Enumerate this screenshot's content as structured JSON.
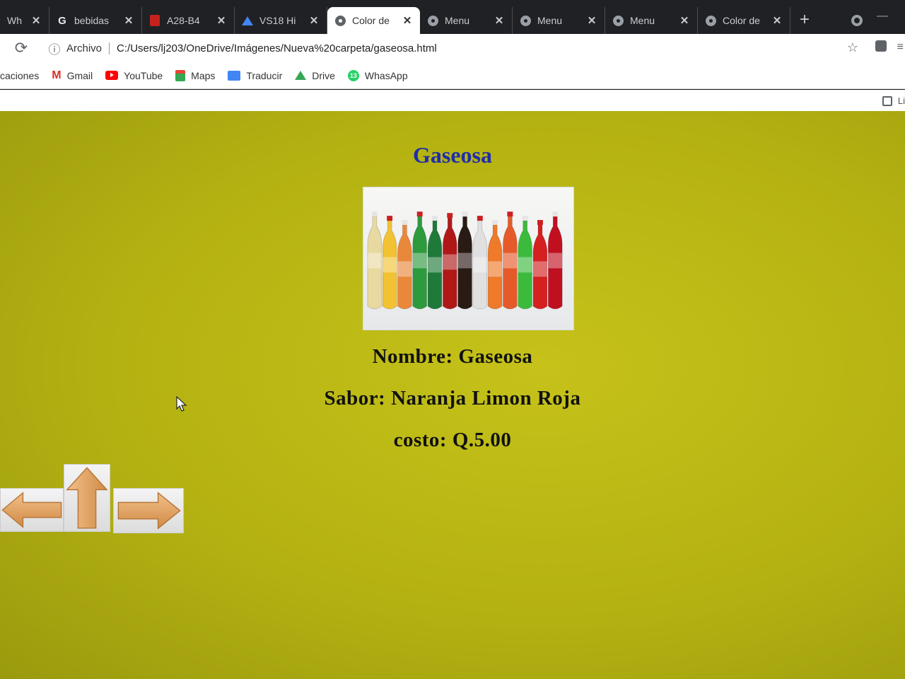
{
  "browser": {
    "tabs": [
      {
        "title": "Wh",
        "icon": "whatsapp-icon",
        "active": false
      },
      {
        "title": "bebidas",
        "icon": "google-icon",
        "active": false
      },
      {
        "title": "A28-B4",
        "icon": "document-icon",
        "active": false
      },
      {
        "title": "VS18 Hi",
        "icon": "drive-icon",
        "active": false
      },
      {
        "title": "Color de",
        "icon": "globe-icon",
        "active": true
      },
      {
        "title": "Menu",
        "icon": "globe-icon",
        "active": false
      },
      {
        "title": "Menu",
        "icon": "globe-icon",
        "active": false
      },
      {
        "title": "Menu",
        "icon": "globe-icon",
        "active": false
      },
      {
        "title": "Color de",
        "icon": "globe-icon",
        "active": false
      }
    ],
    "address": {
      "origin_label": "Archivo",
      "url": "C:/Users/lj203/OneDrive/Imágenes/Nueva%20carpeta/gaseosa.html"
    },
    "bookmarks_apps_label": "caciones",
    "bookmarks": [
      {
        "label": "Gmail",
        "icon": "gmail-icon"
      },
      {
        "label": "YouTube",
        "icon": "youtube-icon"
      },
      {
        "label": "Maps",
        "icon": "maps-icon"
      },
      {
        "label": "Traducir",
        "icon": "translate-icon"
      },
      {
        "label": "Drive",
        "icon": "drive-icon"
      },
      {
        "label": "WhasApp",
        "icon": "whatsapp-icon"
      }
    ],
    "reading_list_label": "Li"
  },
  "page": {
    "title": "Gaseosa",
    "name_line": "Nombre: Gaseosa",
    "flavor_line": "Sabor: Naranja Limon Roja",
    "cost_line": "costo: Q.5.00",
    "image_label": "soda bottles",
    "nav": {
      "left": "arrow-left-icon",
      "up": "arrow-up-icon",
      "right": "arrow-right-icon"
    }
  },
  "colors": {
    "page_background": "#c0be18",
    "title": "#1f2ea8",
    "arrow": "#e0a060"
  }
}
